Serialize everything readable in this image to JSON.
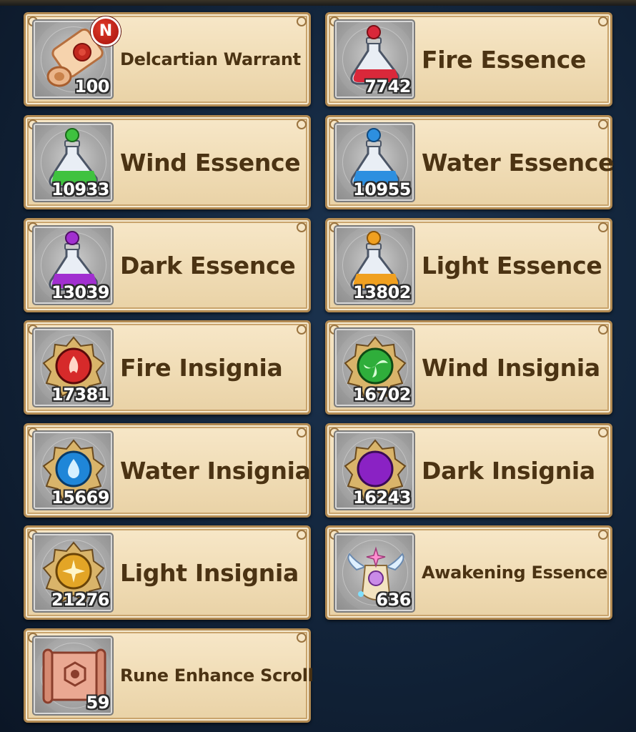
{
  "items": [
    {
      "name": "Delcartian Warrant",
      "quantity": "100",
      "icon": "scroll-warrant-icon",
      "badge": "N"
    },
    {
      "name": "Fire Essence",
      "quantity": "7742",
      "icon": "fire-essence-flask-icon",
      "color": "#d9283a"
    },
    {
      "name": "Wind Essence",
      "quantity": "10933",
      "icon": "wind-essence-flask-icon",
      "color": "#3fc23f"
    },
    {
      "name": "Water Essence",
      "quantity": "10955",
      "icon": "water-essence-flask-icon",
      "color": "#2d8fe0"
    },
    {
      "name": "Dark Essence",
      "quantity": "13039",
      "icon": "dark-essence-flask-icon",
      "color": "#a12fd0"
    },
    {
      "name": "Light Essence",
      "quantity": "13802",
      "icon": "light-essence-flask-icon",
      "color": "#f0a020"
    },
    {
      "name": "Fire Insignia",
      "quantity": "17381",
      "icon": "fire-insignia-icon",
      "color": "#d62a2a"
    },
    {
      "name": "Wind Insignia",
      "quantity": "16702",
      "icon": "wind-insignia-icon",
      "color": "#2fae3b"
    },
    {
      "name": "Water Insignia",
      "quantity": "15669",
      "icon": "water-insignia-icon",
      "color": "#1f86d8"
    },
    {
      "name": "Dark Insignia",
      "quantity": "16243",
      "icon": "dark-insignia-icon",
      "color": "#8a22c4"
    },
    {
      "name": "Light Insignia",
      "quantity": "21276",
      "icon": "light-insignia-icon",
      "color": "#e3a526"
    },
    {
      "name": "Awakening Essence",
      "quantity": "636",
      "icon": "awakening-essence-icon",
      "color": "#c98be8"
    },
    {
      "name": "Rune Enhance Scroll",
      "quantity": "59",
      "icon": "rune-enhance-scroll-icon",
      "color": "#c9766a"
    }
  ]
}
